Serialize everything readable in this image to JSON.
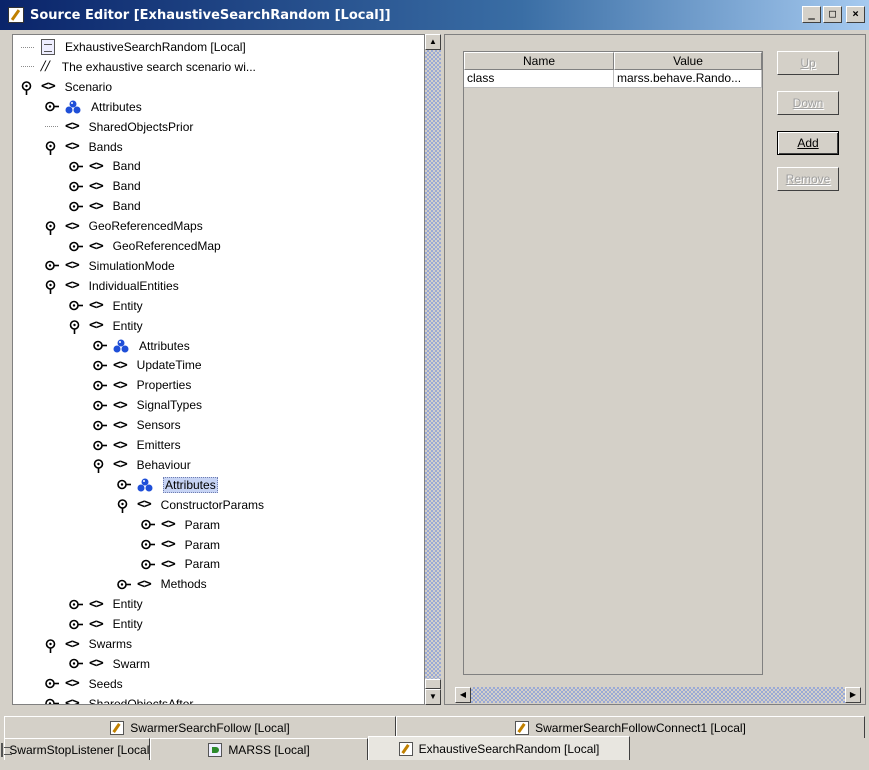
{
  "window": {
    "title": "Source Editor [ExhaustiveSearchRandom [Local]]",
    "minimize_glyph": "_",
    "maximize_glyph": "□",
    "close_glyph": "×"
  },
  "tree": {
    "nodes": [
      {
        "label": "ExhaustiveSearchRandom [Local]",
        "icon": "document-icon",
        "depth": 0,
        "handle": "none"
      },
      {
        "label": "The exhaustive search scenario wi...",
        "icon": "comment-icon",
        "depth": 0,
        "handle": "none"
      },
      {
        "label": "Scenario",
        "icon": "element-icon",
        "depth": 0,
        "handle": "expanded"
      },
      {
        "label": "Attributes",
        "icon": "attributes-icon",
        "depth": 1,
        "handle": "collapsed"
      },
      {
        "label": "SharedObjectsPrior",
        "icon": "element-icon",
        "depth": 1,
        "handle": "none"
      },
      {
        "label": "Bands",
        "icon": "element-icon",
        "depth": 1,
        "handle": "expanded"
      },
      {
        "label": "Band",
        "icon": "element-icon",
        "depth": 2,
        "handle": "collapsed"
      },
      {
        "label": "Band",
        "icon": "element-icon",
        "depth": 2,
        "handle": "collapsed"
      },
      {
        "label": "Band",
        "icon": "element-icon",
        "depth": 2,
        "handle": "collapsed"
      },
      {
        "label": "GeoReferencedMaps",
        "icon": "element-icon",
        "depth": 1,
        "handle": "expanded"
      },
      {
        "label": "GeoReferencedMap",
        "icon": "element-icon",
        "depth": 2,
        "handle": "collapsed"
      },
      {
        "label": "SimulationMode",
        "icon": "element-icon",
        "depth": 1,
        "handle": "collapsed"
      },
      {
        "label": "IndividualEntities",
        "icon": "element-icon",
        "depth": 1,
        "handle": "expanded"
      },
      {
        "label": "Entity",
        "icon": "element-icon",
        "depth": 2,
        "handle": "collapsed"
      },
      {
        "label": "Entity",
        "icon": "element-icon",
        "depth": 2,
        "handle": "expanded"
      },
      {
        "label": "Attributes",
        "icon": "attributes-icon",
        "depth": 3,
        "handle": "collapsed"
      },
      {
        "label": "UpdateTime",
        "icon": "element-icon",
        "depth": 3,
        "handle": "collapsed"
      },
      {
        "label": "Properties",
        "icon": "element-icon",
        "depth": 3,
        "handle": "collapsed"
      },
      {
        "label": "SignalTypes",
        "icon": "element-icon",
        "depth": 3,
        "handle": "collapsed"
      },
      {
        "label": "Sensors",
        "icon": "element-icon",
        "depth": 3,
        "handle": "collapsed"
      },
      {
        "label": "Emitters",
        "icon": "element-icon",
        "depth": 3,
        "handle": "collapsed"
      },
      {
        "label": "Behaviour",
        "icon": "element-icon",
        "depth": 3,
        "handle": "expanded"
      },
      {
        "label": "Attributes",
        "icon": "attributes-icon",
        "depth": 4,
        "handle": "collapsed",
        "selected": true
      },
      {
        "label": "ConstructorParams",
        "icon": "element-icon",
        "depth": 4,
        "handle": "expanded"
      },
      {
        "label": "Param",
        "icon": "element-icon",
        "depth": 5,
        "handle": "collapsed"
      },
      {
        "label": "Param",
        "icon": "element-icon",
        "depth": 5,
        "handle": "collapsed"
      },
      {
        "label": "Param",
        "icon": "element-icon",
        "depth": 5,
        "handle": "collapsed"
      },
      {
        "label": "Methods",
        "icon": "element-icon",
        "depth": 4,
        "handle": "collapsed"
      },
      {
        "label": "Entity",
        "icon": "element-icon",
        "depth": 2,
        "handle": "collapsed"
      },
      {
        "label": "Entity",
        "icon": "element-icon",
        "depth": 2,
        "handle": "collapsed"
      },
      {
        "label": "Swarms",
        "icon": "element-icon",
        "depth": 1,
        "handle": "expanded"
      },
      {
        "label": "Swarm",
        "icon": "element-icon",
        "depth": 2,
        "handle": "collapsed"
      },
      {
        "label": "Seeds",
        "icon": "element-icon",
        "depth": 1,
        "handle": "collapsed"
      },
      {
        "label": "SharedObjectsAfter",
        "icon": "element-icon",
        "depth": 1,
        "handle": "collapsed"
      }
    ]
  },
  "properties": {
    "columns": [
      "Name",
      "Value"
    ],
    "rows": [
      {
        "name": "class",
        "value": "marss.behave.Rando..."
      }
    ]
  },
  "buttons": {
    "up": {
      "label": "Up",
      "enabled": false
    },
    "down": {
      "label": "Down",
      "enabled": false
    },
    "add": {
      "label": "Add",
      "enabled": true
    },
    "remove": {
      "label": "Remove",
      "enabled": false
    }
  },
  "scrollbars": {
    "up_glyph": "▲",
    "down_glyph": "▼",
    "left_glyph": "◀",
    "right_glyph": "▶"
  },
  "tabs": {
    "row1": [
      {
        "label": "SwarmerSearchFollow [Local]",
        "icon": "editor-icon"
      },
      {
        "label": "SwarmerSearchFollowConnect1 [Local]",
        "icon": "editor-icon"
      }
    ],
    "row2": [
      {
        "label": "SwarmStopListener [Local]",
        "icon": "page-icon"
      },
      {
        "label": "MARSS [Local]",
        "icon": "run-icon"
      },
      {
        "label": "ExhaustiveSearchRandom [Local]",
        "icon": "editor-icon",
        "active": true
      }
    ]
  },
  "colors": {
    "titlebar_start": "#0a246a",
    "titlebar_end": "#a6caf0",
    "selection": "#c6d3f4",
    "attribute_icon": "#1f4fd8",
    "window_bg": "#d4d0c8"
  }
}
